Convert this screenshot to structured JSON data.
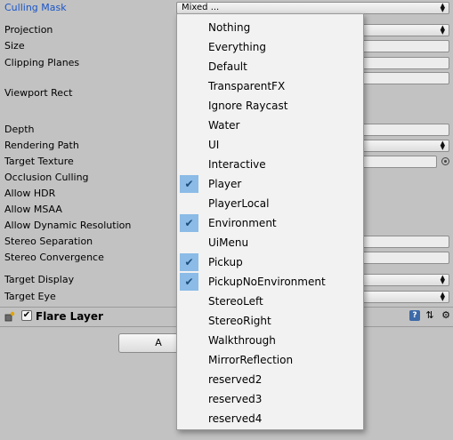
{
  "inspector": {
    "culling_mask": {
      "label": "Culling Mask",
      "value": "Mixed ..."
    },
    "projection": "Projection",
    "size": "Size",
    "clipping_planes": "Clipping Planes",
    "viewport_rect": "Viewport Rect",
    "depth": "Depth",
    "rendering_path": "Rendering Path",
    "target_texture": "Target Texture",
    "occlusion_culling": "Occlusion Culling",
    "allow_hdr": "Allow HDR",
    "allow_msaa": "Allow MSAA",
    "allow_dynamic_resolution": "Allow Dynamic Resolution",
    "stereo_separation": "Stereo Separation",
    "stereo_convergence": "Stereo Convergence",
    "target_display": "Target Display",
    "target_eye": "Target Eye"
  },
  "flare_layer": {
    "title": "Flare Layer",
    "enabled": true,
    "icons": [
      "component-icon",
      "help-icon",
      "preset-icon",
      "gear-icon"
    ]
  },
  "add_button": {
    "label": "A"
  },
  "layer_options": [
    {
      "label": "Nothing",
      "checked": false
    },
    {
      "label": "Everything",
      "checked": false
    },
    {
      "label": "Default",
      "checked": false
    },
    {
      "label": "TransparentFX",
      "checked": false
    },
    {
      "label": "Ignore Raycast",
      "checked": false
    },
    {
      "label": "Water",
      "checked": false
    },
    {
      "label": "UI",
      "checked": false
    },
    {
      "label": "Interactive",
      "checked": false
    },
    {
      "label": "Player",
      "checked": true
    },
    {
      "label": "PlayerLocal",
      "checked": false
    },
    {
      "label": "Environment",
      "checked": true
    },
    {
      "label": "UiMenu",
      "checked": false
    },
    {
      "label": "Pickup",
      "checked": true
    },
    {
      "label": "PickupNoEnvironment",
      "checked": true
    },
    {
      "label": "StereoLeft",
      "checked": false
    },
    {
      "label": "StereoRight",
      "checked": false
    },
    {
      "label": "Walkthrough",
      "checked": false
    },
    {
      "label": "MirrorReflection",
      "checked": false
    },
    {
      "label": "reserved2",
      "checked": false
    },
    {
      "label": "reserved3",
      "checked": false
    },
    {
      "label": "reserved4",
      "checked": false
    }
  ],
  "colors": {
    "background": "#c2c2c2",
    "label_highlight": "#1a55c8",
    "check_highlight": "#8bbbe6"
  }
}
